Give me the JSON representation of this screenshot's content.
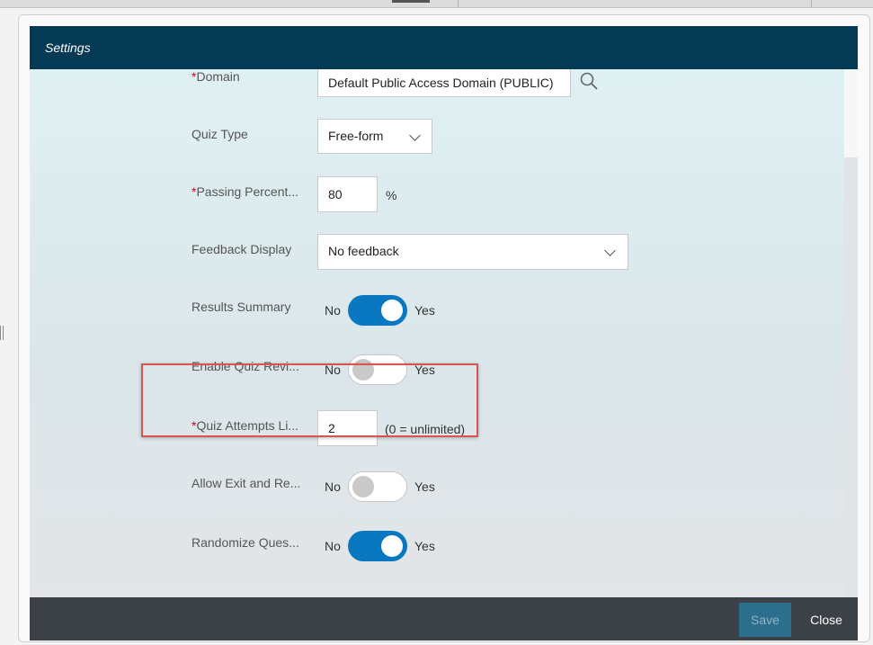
{
  "dialog": {
    "title": "Settings",
    "save_label": "Save",
    "close_label": "Close"
  },
  "fields": {
    "domain": {
      "label": "Domain",
      "required": "*",
      "value": "Default Public Access Domain (PUBLIC)",
      "icon": "search-icon"
    },
    "quiz_type": {
      "label": "Quiz Type",
      "value": "Free-form"
    },
    "passing_percent": {
      "label": "Passing Percent...",
      "required": "*",
      "value": "80",
      "unit": "%"
    },
    "feedback_display": {
      "label": "Feedback Display",
      "value": "No feedback"
    },
    "results_summary": {
      "label": "Results Summary",
      "no": "No",
      "yes": "Yes",
      "state": "on"
    },
    "enable_quiz_review": {
      "label": "Enable Quiz Revi...",
      "no": "No",
      "yes": "Yes",
      "state": "off"
    },
    "quiz_attempts": {
      "label": "Quiz Attempts Li...",
      "required": "*",
      "value": "2",
      "hint": "(0 = unlimited)"
    },
    "allow_exit": {
      "label": "Allow Exit and Re...",
      "no": "No",
      "yes": "Yes",
      "state": "off"
    },
    "randomize_questions": {
      "label": "Randomize Ques...",
      "no": "No",
      "yes": "Yes",
      "state": "on"
    }
  },
  "colors": {
    "header": "#053a55",
    "footer": "#3c4147",
    "toggle_on": "#0a78c0",
    "highlight": "#d9534f",
    "required": "#d0021b"
  }
}
